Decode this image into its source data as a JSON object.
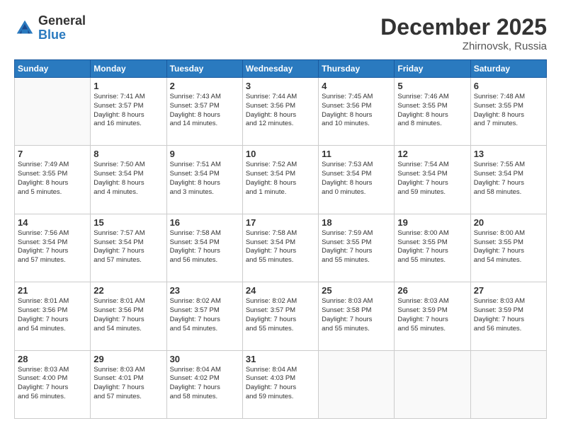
{
  "logo": {
    "general": "General",
    "blue": "Blue"
  },
  "title": {
    "month_year": "December 2025",
    "location": "Zhirnovsk, Russia"
  },
  "headers": [
    "Sunday",
    "Monday",
    "Tuesday",
    "Wednesday",
    "Thursday",
    "Friday",
    "Saturday"
  ],
  "weeks": [
    [
      {
        "day": "",
        "info": ""
      },
      {
        "day": "1",
        "info": "Sunrise: 7:41 AM\nSunset: 3:57 PM\nDaylight: 8 hours\nand 16 minutes."
      },
      {
        "day": "2",
        "info": "Sunrise: 7:43 AM\nSunset: 3:57 PM\nDaylight: 8 hours\nand 14 minutes."
      },
      {
        "day": "3",
        "info": "Sunrise: 7:44 AM\nSunset: 3:56 PM\nDaylight: 8 hours\nand 12 minutes."
      },
      {
        "day": "4",
        "info": "Sunrise: 7:45 AM\nSunset: 3:56 PM\nDaylight: 8 hours\nand 10 minutes."
      },
      {
        "day": "5",
        "info": "Sunrise: 7:46 AM\nSunset: 3:55 PM\nDaylight: 8 hours\nand 8 minutes."
      },
      {
        "day": "6",
        "info": "Sunrise: 7:48 AM\nSunset: 3:55 PM\nDaylight: 8 hours\nand 7 minutes."
      }
    ],
    [
      {
        "day": "7",
        "info": "Sunrise: 7:49 AM\nSunset: 3:55 PM\nDaylight: 8 hours\nand 5 minutes."
      },
      {
        "day": "8",
        "info": "Sunrise: 7:50 AM\nSunset: 3:54 PM\nDaylight: 8 hours\nand 4 minutes."
      },
      {
        "day": "9",
        "info": "Sunrise: 7:51 AM\nSunset: 3:54 PM\nDaylight: 8 hours\nand 3 minutes."
      },
      {
        "day": "10",
        "info": "Sunrise: 7:52 AM\nSunset: 3:54 PM\nDaylight: 8 hours\nand 1 minute."
      },
      {
        "day": "11",
        "info": "Sunrise: 7:53 AM\nSunset: 3:54 PM\nDaylight: 8 hours\nand 0 minutes."
      },
      {
        "day": "12",
        "info": "Sunrise: 7:54 AM\nSunset: 3:54 PM\nDaylight: 7 hours\nand 59 minutes."
      },
      {
        "day": "13",
        "info": "Sunrise: 7:55 AM\nSunset: 3:54 PM\nDaylight: 7 hours\nand 58 minutes."
      }
    ],
    [
      {
        "day": "14",
        "info": "Sunrise: 7:56 AM\nSunset: 3:54 PM\nDaylight: 7 hours\nand 57 minutes."
      },
      {
        "day": "15",
        "info": "Sunrise: 7:57 AM\nSunset: 3:54 PM\nDaylight: 7 hours\nand 57 minutes."
      },
      {
        "day": "16",
        "info": "Sunrise: 7:58 AM\nSunset: 3:54 PM\nDaylight: 7 hours\nand 56 minutes."
      },
      {
        "day": "17",
        "info": "Sunrise: 7:58 AM\nSunset: 3:54 PM\nDaylight: 7 hours\nand 55 minutes."
      },
      {
        "day": "18",
        "info": "Sunrise: 7:59 AM\nSunset: 3:55 PM\nDaylight: 7 hours\nand 55 minutes."
      },
      {
        "day": "19",
        "info": "Sunrise: 8:00 AM\nSunset: 3:55 PM\nDaylight: 7 hours\nand 55 minutes."
      },
      {
        "day": "20",
        "info": "Sunrise: 8:00 AM\nSunset: 3:55 PM\nDaylight: 7 hours\nand 54 minutes."
      }
    ],
    [
      {
        "day": "21",
        "info": "Sunrise: 8:01 AM\nSunset: 3:56 PM\nDaylight: 7 hours\nand 54 minutes."
      },
      {
        "day": "22",
        "info": "Sunrise: 8:01 AM\nSunset: 3:56 PM\nDaylight: 7 hours\nand 54 minutes."
      },
      {
        "day": "23",
        "info": "Sunrise: 8:02 AM\nSunset: 3:57 PM\nDaylight: 7 hours\nand 54 minutes."
      },
      {
        "day": "24",
        "info": "Sunrise: 8:02 AM\nSunset: 3:57 PM\nDaylight: 7 hours\nand 55 minutes."
      },
      {
        "day": "25",
        "info": "Sunrise: 8:03 AM\nSunset: 3:58 PM\nDaylight: 7 hours\nand 55 minutes."
      },
      {
        "day": "26",
        "info": "Sunrise: 8:03 AM\nSunset: 3:59 PM\nDaylight: 7 hours\nand 55 minutes."
      },
      {
        "day": "27",
        "info": "Sunrise: 8:03 AM\nSunset: 3:59 PM\nDaylight: 7 hours\nand 56 minutes."
      }
    ],
    [
      {
        "day": "28",
        "info": "Sunrise: 8:03 AM\nSunset: 4:00 PM\nDaylight: 7 hours\nand 56 minutes."
      },
      {
        "day": "29",
        "info": "Sunrise: 8:03 AM\nSunset: 4:01 PM\nDaylight: 7 hours\nand 57 minutes."
      },
      {
        "day": "30",
        "info": "Sunrise: 8:04 AM\nSunset: 4:02 PM\nDaylight: 7 hours\nand 58 minutes."
      },
      {
        "day": "31",
        "info": "Sunrise: 8:04 AM\nSunset: 4:03 PM\nDaylight: 7 hours\nand 59 minutes."
      },
      {
        "day": "",
        "info": ""
      },
      {
        "day": "",
        "info": ""
      },
      {
        "day": "",
        "info": ""
      }
    ]
  ]
}
